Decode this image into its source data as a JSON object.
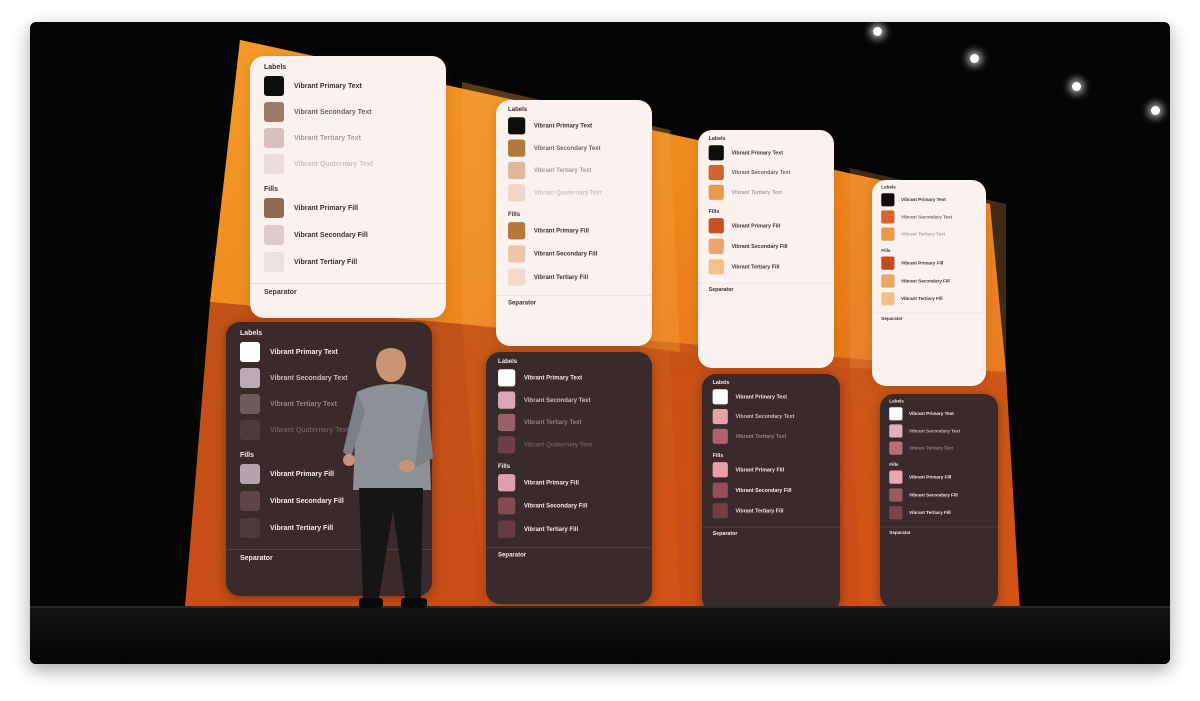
{
  "stage": {
    "panels": [
      {
        "id": "light-1",
        "theme": "light",
        "sections": {
          "labels": "Labels",
          "fills": "Fills",
          "separator": "Separator"
        },
        "label_rows": [
          {
            "text": "Vibrant Primary Text",
            "color": "#0e0e0e"
          },
          {
            "text": "Vibrant Secondary Text",
            "color": "#9a7b6c"
          },
          {
            "text": "Vibrant Tertiary Text",
            "color": "#d9c0bd"
          },
          {
            "text": "Vibrant Quaternary Text",
            "color": "#ecdcdc"
          }
        ],
        "fill_rows": [
          {
            "text": "Vibrant Primary Fill",
            "color": "#8f6a4f"
          },
          {
            "text": "Vibrant Secondary Fill",
            "color": "#dccbc9"
          },
          {
            "text": "Vibrant Tertiary Fill",
            "color": "#ecdfdf"
          }
        ]
      },
      {
        "id": "light-2",
        "theme": "light",
        "sections": {
          "labels": "Labels",
          "fills": "Fills",
          "separator": "Separator"
        },
        "label_rows": [
          {
            "text": "Vibrant Primary Text",
            "color": "#0e0e0e"
          },
          {
            "text": "Vibrant Secondary Text",
            "color": "#b17a3d"
          },
          {
            "text": "Vibrant Tertiary Text",
            "color": "#e1b79a"
          },
          {
            "text": "Vibrant Quaternary Text",
            "color": "#f0d6c8"
          }
        ],
        "fill_rows": [
          {
            "text": "Vibrant Primary Fill",
            "color": "#b8763a"
          },
          {
            "text": "Vibrant Secondary Fill",
            "color": "#ecc6a9"
          },
          {
            "text": "Vibrant Tertiary Fill",
            "color": "#f2dbcc"
          }
        ]
      },
      {
        "id": "light-3",
        "theme": "light",
        "sections": {
          "labels": "Labels",
          "fills": "Fills",
          "separator": "Separator"
        },
        "label_rows": [
          {
            "text": "Vibrant Primary Text",
            "color": "#0e0e0e"
          },
          {
            "text": "Vibrant Secondary Text",
            "color": "#d1642c"
          },
          {
            "text": "Vibrant Tertiary Text",
            "color": "#e99a4c"
          }
        ],
        "fill_rows": [
          {
            "text": "Vibrant Primary Fill",
            "color": "#cc4f22"
          },
          {
            "text": "Vibrant Secondary Fill",
            "color": "#eea56b"
          },
          {
            "text": "Vibrant Tertiary Fill",
            "color": "#f2c08e"
          }
        ]
      },
      {
        "id": "light-4",
        "theme": "light",
        "sections": {
          "labels": "Labels",
          "fills": "Fills",
          "separator": "Separator"
        },
        "label_rows": [
          {
            "text": "Vibrant Primary Text",
            "color": "#0e0e0e"
          },
          {
            "text": "Vibrant Secondary Text",
            "color": "#d9622a"
          },
          {
            "text": "Vibrant Tertiary Text",
            "color": "#e69a45"
          }
        ],
        "fill_rows": [
          {
            "text": "Vibrant Primary Fill",
            "color": "#c7491e"
          },
          {
            "text": "Vibrant Secondary Fill",
            "color": "#eaa661"
          },
          {
            "text": "Vibrant Tertiary Fill",
            "color": "#efc287"
          }
        ]
      },
      {
        "id": "dark-1",
        "theme": "dark",
        "sections": {
          "labels": "Labels",
          "fills": "Fills",
          "separator": "Separator"
        },
        "label_rows": [
          {
            "text": "Vibrant Primary Text",
            "color": "#ffffff"
          },
          {
            "text": "Vibrant Secondary Text",
            "color": "#b9aab5"
          },
          {
            "text": "Vibrant Tertiary Text",
            "color": "#6e5a5d"
          },
          {
            "text": "Vibrant Quaternary Text",
            "color": "#4e3b3d"
          }
        ],
        "fill_rows": [
          {
            "text": "Vibrant Primary Fill",
            "color": "#b4a2ad"
          },
          {
            "text": "Vibrant Secondary Fill",
            "color": "#5d4548"
          },
          {
            "text": "Vibrant Tertiary Fill",
            "color": "#4b393b"
          }
        ]
      },
      {
        "id": "dark-2",
        "theme": "dark",
        "sections": {
          "labels": "Labels",
          "fills": "Fills",
          "separator": "Separator"
        },
        "label_rows": [
          {
            "text": "Vibrant Primary Text",
            "color": "#ffffff"
          },
          {
            "text": "Vibrant Secondary Text",
            "color": "#d7a9b7"
          },
          {
            "text": "Vibrant Tertiary Text",
            "color": "#9a5f68"
          },
          {
            "text": "Vibrant Quaternary Text",
            "color": "#6a4044"
          }
        ],
        "fill_rows": [
          {
            "text": "Vibrant Primary Fill",
            "color": "#dca0ad"
          },
          {
            "text": "Vibrant Secondary Fill",
            "color": "#7f4c50"
          },
          {
            "text": "Vibrant Tertiary Fill",
            "color": "#643d40"
          }
        ]
      },
      {
        "id": "dark-3",
        "theme": "dark",
        "sections": {
          "labels": "Labels",
          "fills": "Fills",
          "separator": "Separator"
        },
        "label_rows": [
          {
            "text": "Vibrant Primary Text",
            "color": "#ffffff"
          },
          {
            "text": "Vibrant Secondary Text",
            "color": "#e3a3a9"
          },
          {
            "text": "Vibrant Tertiary Text",
            "color": "#b0626a"
          }
        ],
        "fill_rows": [
          {
            "text": "Vibrant Primary Fill",
            "color": "#e8a0a6"
          },
          {
            "text": "Vibrant Secondary Fill",
            "color": "#94505a"
          },
          {
            "text": "Vibrant Tertiary Fill",
            "color": "#723f45"
          }
        ]
      },
      {
        "id": "dark-4",
        "theme": "dark",
        "sections": {
          "labels": "Labels",
          "fills": "Fills",
          "separator": "Separator"
        },
        "label_rows": [
          {
            "text": "Vibrant Primary Text",
            "color": "#ffffff"
          },
          {
            "text": "Vibrant Secondary Text",
            "color": "#e6aeb7"
          },
          {
            "text": "Vibrant Tertiary Text",
            "color": "#b76e78"
          }
        ],
        "fill_rows": [
          {
            "text": "Vibrant Primary Fill",
            "color": "#eaa9b2"
          },
          {
            "text": "Vibrant Secondary Fill",
            "color": "#9a5a62"
          },
          {
            "text": "Vibrant Tertiary Fill",
            "color": "#7a454b"
          }
        ]
      }
    ]
  },
  "colors": {
    "backdrop": "#050505",
    "screen_orange_top": "#ee8a1c",
    "screen_orange_bottom": "#c34d12",
    "light_card": "#fbf1ef",
    "dark_card": "#3a2a2c"
  }
}
